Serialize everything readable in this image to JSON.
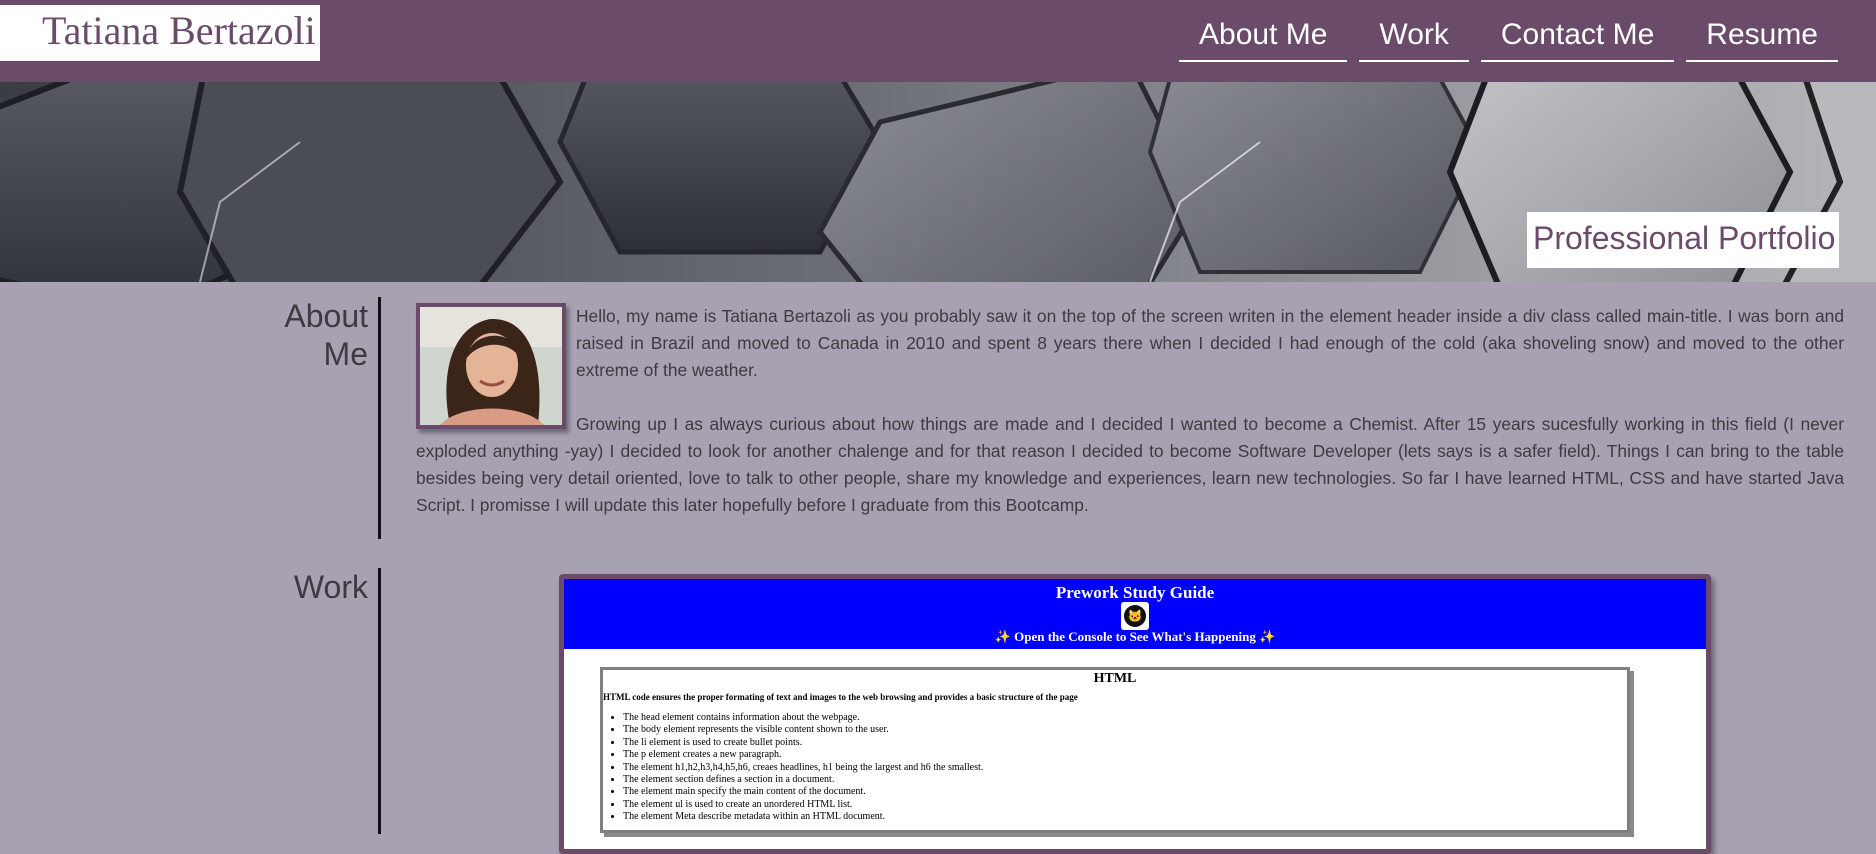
{
  "header": {
    "main_title": "Tatiana Bertazoli",
    "nav": [
      "About Me",
      "Work",
      "Contact Me",
      "Resume"
    ]
  },
  "hero": {
    "title": "Professional Portfolio"
  },
  "about": {
    "label_line1": "About",
    "label_line2": "Me",
    "paragraph1": "Hello, my name is Tatiana Bertazoli as you probably saw it on the top of the screen writen in the element header inside a div class called main-title. I was born and raised in Brazil and moved to Canada in 2010 and spent 8 years there when I decided I had enough of the cold (aka shoveling snow) and moved to the other extreme of the weather.",
    "paragraph2": "Growing up I as always curious about how things are made and I decided I wanted to become a Chemist. After 15 years sucesfully working in this field (I never exploded anything -yay) I decided to look for another chalenge and for that reason I decided to become Software Developer (lets says is a safer field). Things I can bring to the table besides being very detail oriented, love to talk to other people, share my knowledge and experiences, learn new technologies. So far I have learned HTML, CSS and have started Java Script. I promisse I will update this later hopefully before I graduate from this Bootcamp."
  },
  "work": {
    "label": "Work",
    "project": {
      "title": "Prework Study Guide",
      "subtitle": "✨ Open the Console to See What's Happening ✨",
      "card_title": "HTML",
      "card_desc": "HTML code ensures the proper formating of text and images to the web browsing and provides a basic structure of the page",
      "items": [
        "The head element contains information about the webpage.",
        "The body element represents the visible content shown to the user.",
        "The li element is used to create bullet points.",
        "The p element creates a new paragraph.",
        "The element h1,h2,h3,h4,h5,h6, creaes headlines, h1 being the largest and h6 the smallest.",
        "The element section defines a section in a document.",
        "The element main specify the main content of the document.",
        "The element ul is used to create an unordered HTML list.",
        "The element Meta describe metadata within an HTML document."
      ]
    }
  },
  "colors": {
    "header_bg": "#6a4b6a",
    "page_bg": "#a8a1b2",
    "project_banner": "#0000ff"
  }
}
